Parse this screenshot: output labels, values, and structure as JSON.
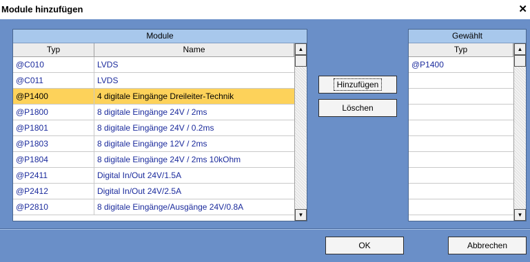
{
  "dialog": {
    "title": "Module hinzufügen",
    "close_label": "✕"
  },
  "modules": {
    "header": "Module",
    "columns": [
      "Typ",
      "Name"
    ],
    "rows": [
      {
        "typ": "@C010",
        "name": "LVDS",
        "selected": false
      },
      {
        "typ": "@C011",
        "name": "LVDS",
        "selected": false
      },
      {
        "typ": "@P1400",
        "name": "4 digitale Eingänge Dreileiter-Technik",
        "selected": true
      },
      {
        "typ": "@P1800",
        "name": "8 digitale Eingänge 24V / 2ms",
        "selected": false
      },
      {
        "typ": "@P1801",
        "name": "8 digitale Eingänge 24V / 0.2ms",
        "selected": false
      },
      {
        "typ": "@P1803",
        "name": "8 digitale Eingänge 12V / 2ms",
        "selected": false
      },
      {
        "typ": "@P1804",
        "name": "8 digitale Eingänge 24V / 2ms 10kOhm",
        "selected": false
      },
      {
        "typ": "@P2411",
        "name": "Digital In/Out 24V/1.5A",
        "selected": false
      },
      {
        "typ": "@P2412",
        "name": "Digital In/Out 24V/2.5A",
        "selected": false
      },
      {
        "typ": "@P2810",
        "name": "8 digitale Eingänge/Ausgänge 24V/0.8A",
        "selected": false
      }
    ]
  },
  "selected_list": {
    "header": "Gewählt",
    "columns": [
      "Typ"
    ],
    "rows": [
      {
        "typ": "@P1400"
      }
    ]
  },
  "buttons": {
    "add": "Hinzufügen",
    "delete": "Löschen",
    "ok": "OK",
    "cancel": "Abbrechen"
  },
  "colors": {
    "dialog_bg": "#6a8fc8",
    "header_bg": "#a8c8ec",
    "selected_row": "#fdd25a",
    "row_text": "#1a2a9c"
  }
}
